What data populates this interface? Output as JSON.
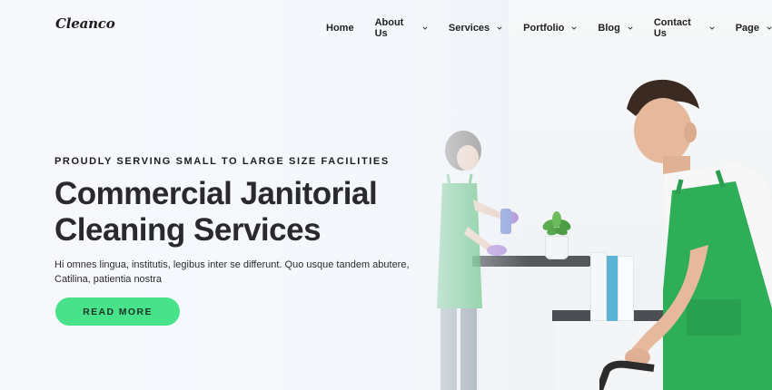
{
  "brand": {
    "logo": "Cleanco"
  },
  "nav": {
    "items": [
      {
        "label": "Home",
        "has_dropdown": false
      },
      {
        "label": "About Us",
        "has_dropdown": true
      },
      {
        "label": "Services",
        "has_dropdown": true
      },
      {
        "label": "Portfolio",
        "has_dropdown": true
      },
      {
        "label": "Blog",
        "has_dropdown": true
      },
      {
        "label": "Contact Us",
        "has_dropdown": true
      },
      {
        "label": "Page",
        "has_dropdown": true
      }
    ]
  },
  "hero": {
    "eyebrow": "PROUDLY SERVING SMALL TO LARGE SIZE FACILITIES",
    "headline": "Commercial Janitorial Cleaning Services",
    "body": "Hi omnes lingua, institutis, legibus inter se differunt. Quo usque tandem abutere, Catilina, patientia nostra",
    "cta_label": "READ MORE"
  },
  "colors": {
    "accent": "#48e28a",
    "apron_green": "#2fae58",
    "text_dark": "#2a2a2e"
  }
}
